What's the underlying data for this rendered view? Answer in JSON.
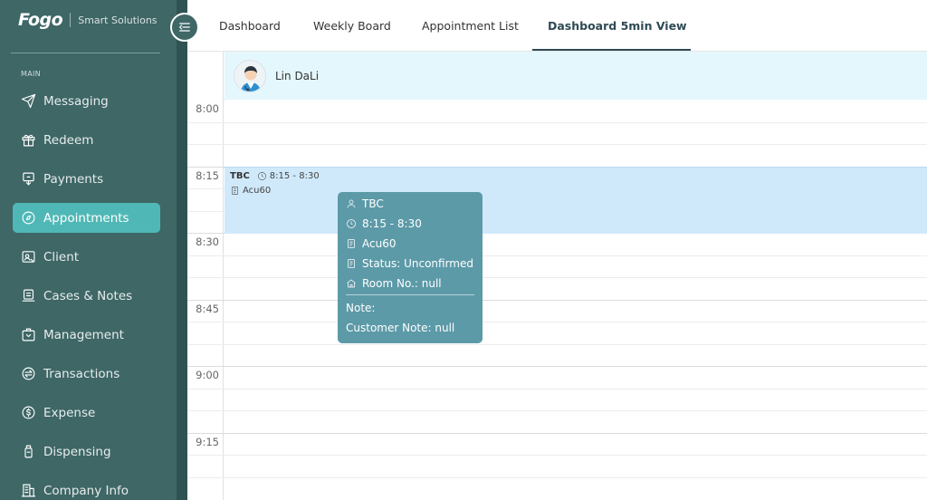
{
  "brand": {
    "logo": "Fogo",
    "subtitle": "Smart Solutions"
  },
  "sidebar": {
    "section": "MAIN",
    "items": [
      {
        "label": "Messaging",
        "icon": "send-icon"
      },
      {
        "label": "Redeem",
        "icon": "gift-icon"
      },
      {
        "label": "Payments",
        "icon": "payments-icon"
      },
      {
        "label": "Appointments",
        "icon": "compass-icon",
        "active": true
      },
      {
        "label": "Client",
        "icon": "client-card-icon"
      },
      {
        "label": "Cases & Notes",
        "icon": "notes-icon"
      },
      {
        "label": "Management",
        "icon": "management-icon"
      },
      {
        "label": "Transactions",
        "icon": "transfer-icon"
      },
      {
        "label": "Expense",
        "icon": "expense-icon"
      },
      {
        "label": "Dispensing",
        "icon": "bottle-icon"
      },
      {
        "label": "Company Info",
        "icon": "building-icon"
      }
    ]
  },
  "tabs": [
    {
      "label": "Dashboard"
    },
    {
      "label": "Weekly Board"
    },
    {
      "label": "Appointment List"
    },
    {
      "label": "Dashboard 5min View",
      "active": true
    }
  ],
  "calendar": {
    "resource": {
      "name": "Lin DaLi"
    },
    "times": [
      "8:00",
      "8:15",
      "8:30",
      "8:45",
      "9:00",
      "9:15"
    ],
    "event": {
      "title": "TBC",
      "time": "8:15 - 8:30",
      "service": "Acu60"
    }
  },
  "tooltip": {
    "name": "TBC",
    "time": "8:15 - 8:30",
    "service": "Acu60",
    "status": "Status: Unconfirmed",
    "room": "Room No.: null",
    "note": "Note:",
    "customer_note": "Customer Note: null"
  },
  "colors": {
    "sidebar_bg": "#3e6766",
    "active_item": "#4fb8b6",
    "event_bg": "#cfe9fb",
    "resource_header_bg": "#e4f7fc",
    "tooltip_bg": "#5c9aa8",
    "tab_active": "#2f4a55"
  }
}
